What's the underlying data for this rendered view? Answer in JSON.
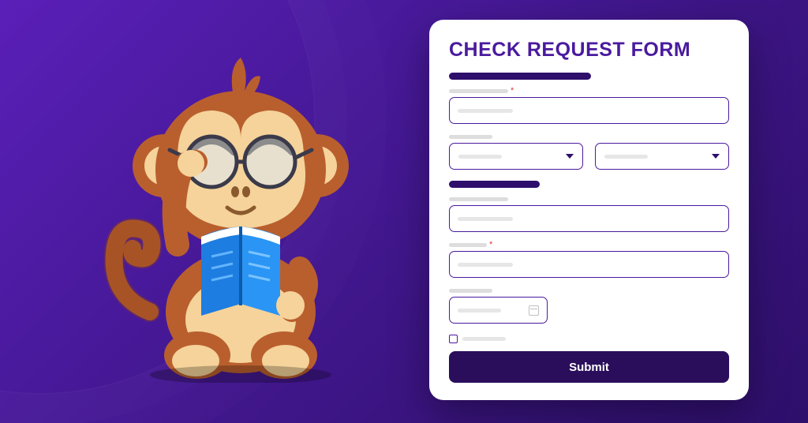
{
  "form": {
    "title": "CHECK REQUEST FORM",
    "submit_label": "Submit"
  },
  "colors": {
    "accent": "#4a1a9e",
    "button_bg": "#2a0e5c",
    "background_start": "#5a1fb8",
    "background_end": "#2e0f6b"
  },
  "mascot": {
    "description": "cartoon monkey with glasses reading a blue book"
  }
}
